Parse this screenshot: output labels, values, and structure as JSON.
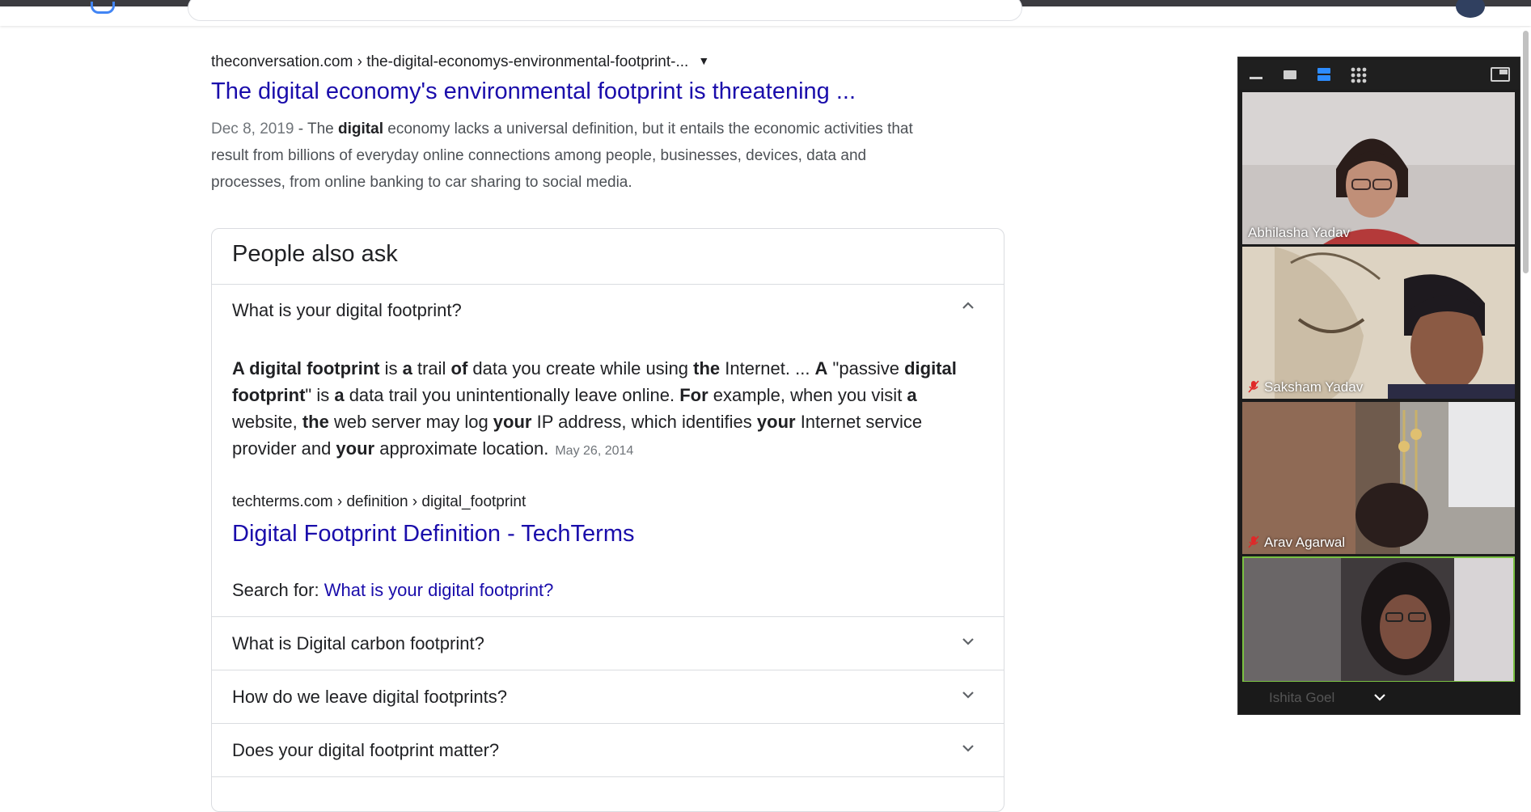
{
  "result": {
    "cite": "theconversation.com › the-digital-economys-environmental-footprint-...",
    "title": "The digital economy's environmental footprint is threatening ...",
    "snippet_date": "Dec 8, 2019",
    "snippet_sep": " - The ",
    "snippet_bold": "digital",
    "snippet_rest": " economy lacks a universal definition, but it entails the economic activities that result from billions of everyday online connections among people, businesses, devices, data and processes, from online banking to car sharing to social media."
  },
  "paa": {
    "heading": "People also ask",
    "open_question": "What is your digital footprint?",
    "answer_parts": [
      {
        "b": true,
        "t": "A digital footprint"
      },
      {
        "b": false,
        "t": " is "
      },
      {
        "b": true,
        "t": "a"
      },
      {
        "b": false,
        "t": " trail "
      },
      {
        "b": true,
        "t": "of"
      },
      {
        "b": false,
        "t": " data you create while using "
      },
      {
        "b": true,
        "t": "the"
      },
      {
        "b": false,
        "t": " Internet. ... "
      },
      {
        "b": true,
        "t": "A"
      },
      {
        "b": false,
        "t": " \"passive "
      },
      {
        "b": true,
        "t": "digital footprint"
      },
      {
        "b": false,
        "t": "\" is "
      },
      {
        "b": true,
        "t": "a"
      },
      {
        "b": false,
        "t": " data trail you unintentionally leave online. "
      },
      {
        "b": true,
        "t": "For"
      },
      {
        "b": false,
        "t": " example, when you visit "
      },
      {
        "b": true,
        "t": "a"
      },
      {
        "b": false,
        "t": " website, "
      },
      {
        "b": true,
        "t": "the"
      },
      {
        "b": false,
        "t": " web server may log "
      },
      {
        "b": true,
        "t": "your"
      },
      {
        "b": false,
        "t": " IP address, which identifies "
      },
      {
        "b": true,
        "t": "your"
      },
      {
        "b": false,
        "t": " Internet service provider and "
      },
      {
        "b": true,
        "t": "your"
      },
      {
        "b": false,
        "t": " approximate location."
      }
    ],
    "answer_date": "May 26, 2014",
    "source_cite": "techterms.com › definition › digital_footprint",
    "source_title": "Digital Footprint Definition - TechTerms",
    "search_for_label": "Search for: ",
    "search_for_link": "What is your digital footprint?",
    "questions": [
      "What is Digital carbon footprint?",
      "How do we leave digital footprints?",
      "Does your digital footprint matter?"
    ]
  },
  "zoom": {
    "participants": [
      {
        "name": "Abhilasha Yadav",
        "muted": false
      },
      {
        "name": "Saksham Yadav",
        "muted": true
      },
      {
        "name": "Arav Agarwal",
        "muted": true
      },
      {
        "name": "Ishita Goel",
        "muted": true
      }
    ]
  },
  "colors": {
    "link": "#1a0dab",
    "active_speaker": "#7ac142",
    "muted_icon": "#e02828"
  }
}
